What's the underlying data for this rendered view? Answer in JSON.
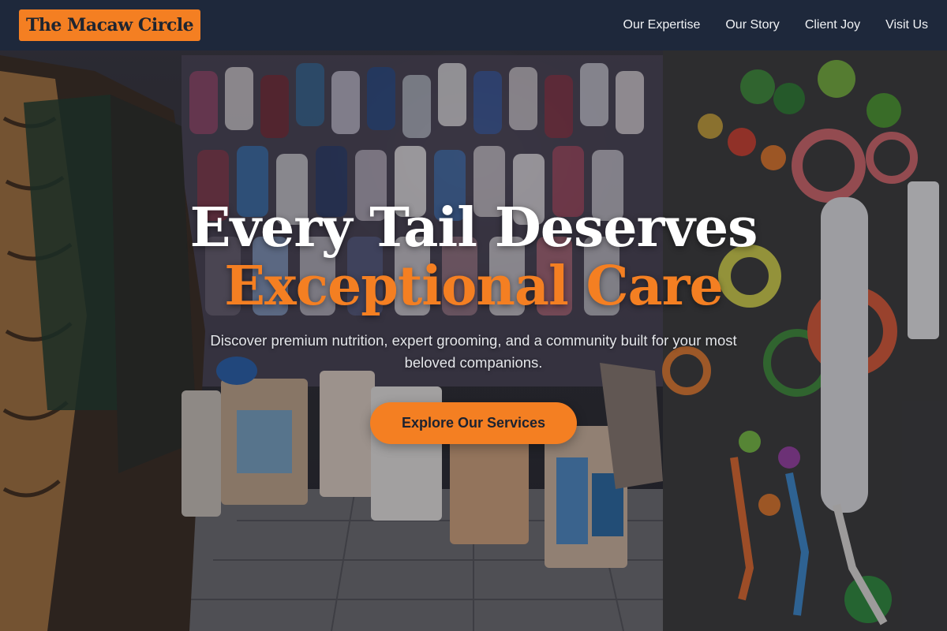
{
  "brand": {
    "logo_text": "The Macaw Circle",
    "accent_color": "#f47f22",
    "nav_bg_color": "#1e293b"
  },
  "nav": {
    "links": [
      {
        "label": "Our Expertise"
      },
      {
        "label": "Our Story"
      },
      {
        "label": "Client Joy"
      },
      {
        "label": "Visit Us"
      }
    ]
  },
  "hero": {
    "headline_line1": "Every Tail Deserves",
    "headline_line2": "Exceptional Care",
    "subheadline": "Discover premium nutrition, expert grooming, and a community built for your most beloved companions.",
    "cta_label": "Explore Our Services",
    "background_image": "pet-store-interior-photo"
  }
}
